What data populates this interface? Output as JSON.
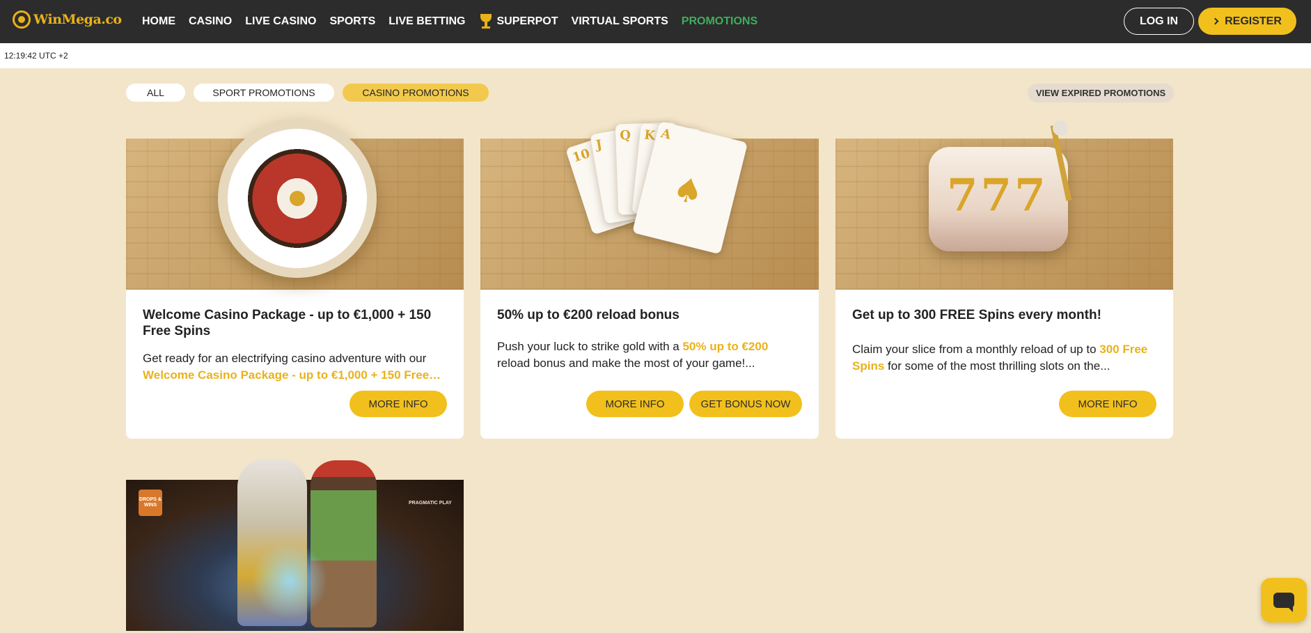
{
  "brand": {
    "logo_text": "WinMega.co",
    "accent": "#f2c01c",
    "active_nav": "#3fae5d"
  },
  "nav": {
    "items": [
      {
        "label": "HOME"
      },
      {
        "label": "CASINO"
      },
      {
        "label": "LIVE CASINO"
      },
      {
        "label": "SPORTS"
      },
      {
        "label": "LIVE BETTING"
      },
      {
        "label": "SUPERPOT",
        "icon": "trophy-icon"
      },
      {
        "label": "VIRTUAL SPORTS"
      },
      {
        "label": "PROMOTIONS",
        "active": true
      }
    ],
    "login_label": "LOG IN",
    "register_label": "REGISTER"
  },
  "clock": {
    "text": "12:19:42 UTC +2"
  },
  "filters": {
    "all_label": "ALL",
    "sport_label": "SPORT PROMOTIONS",
    "casino_label": "CASINO PROMOTIONS",
    "selected": "CASINO PROMOTIONS",
    "expired_label": "VIEW EXPIRED PROMOTIONS"
  },
  "promotions": [
    {
      "title": "Welcome Casino Package - up to €1,000 + 150 Free Spins",
      "desc_before": "Get ready for an electrifying casino adventure with our ",
      "desc_highlight": "Welcome Casino Package - up to €1,000 + 150 Free…",
      "desc_after": "",
      "buttons": [
        "MORE INFO"
      ]
    },
    {
      "title": "50% up to €200 reload bonus",
      "desc_before": "Push your luck to strike gold with a ",
      "desc_highlight": "50% up to €200",
      "desc_after": " reload bonus and make the most of your game!...",
      "buttons": [
        "MORE INFO",
        "GET BONUS NOW"
      ]
    },
    {
      "title": "Get up to 300 FREE Spins every month!",
      "desc_before": "Claim your slice from a monthly reload of up to ",
      "desc_highlight": "300 Free Spins",
      "desc_after": " for some of the most thrilling slots on the...",
      "buttons": [
        "MORE INFO"
      ]
    }
  ],
  "card4": {
    "badge_text": "DROPS & WINS",
    "provider_text": "PRAGMATIC PLAY"
  },
  "decor": {
    "card_text": [
      "10",
      "J",
      "Q",
      "K",
      "A"
    ],
    "slot_digits": "777"
  },
  "chat": {
    "icon": "chat-icon"
  }
}
